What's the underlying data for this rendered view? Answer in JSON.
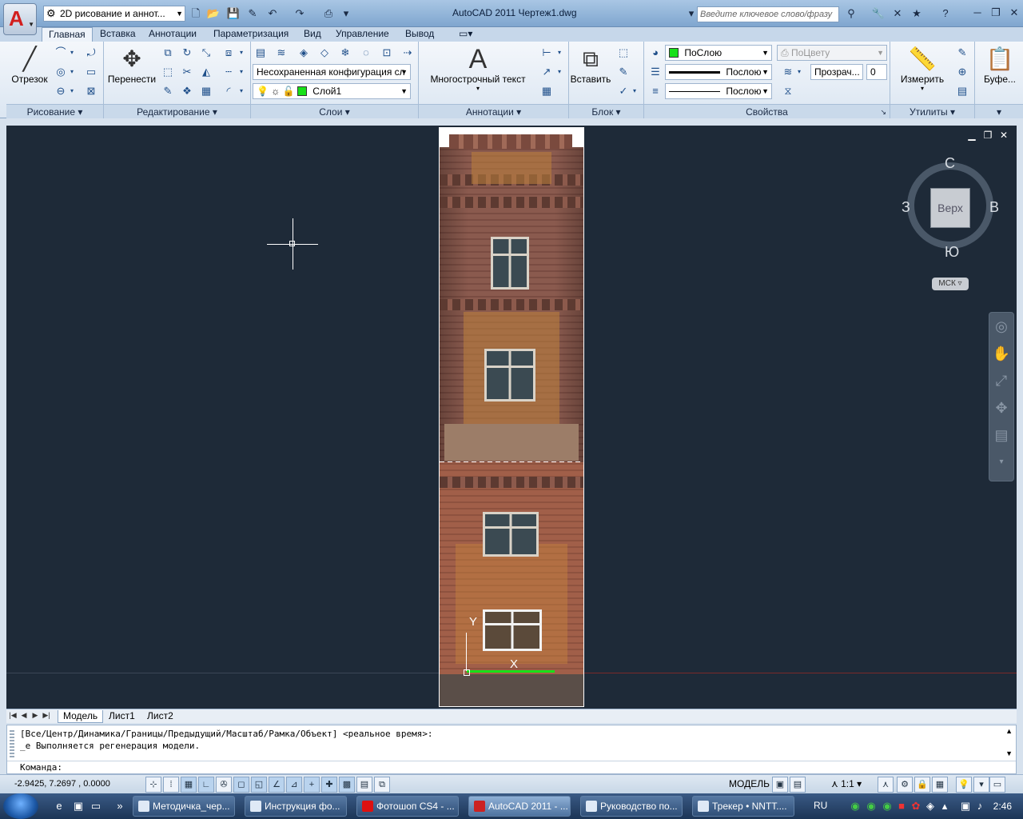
{
  "titlebar": {
    "workspace": "2D рисование и аннот...",
    "app_title": "AutoCAD 2011     Чертеж1.dwg",
    "search_placeholder": "Введите ключевое слово/фразу"
  },
  "ribbon_tabs": [
    "Главная",
    "Вставка",
    "Аннотации",
    "Параметризация",
    "Вид",
    "Управление",
    "Вывод"
  ],
  "panels": {
    "draw": {
      "title": "Рисование",
      "line_label": "Отрезок"
    },
    "modify": {
      "title": "Редактирование",
      "move_label": "Перенести"
    },
    "layers": {
      "title": "Слои",
      "state_combo": "Несохраненная конфигурация сл",
      "layer_combo": "Слой1"
    },
    "annotation": {
      "title": "Аннотации",
      "mtext_label": "Многострочный текст"
    },
    "block": {
      "title": "Блок",
      "insert_label": "Вставить"
    },
    "properties": {
      "title": "Свойства",
      "color_combo": "ПоСлою",
      "lineweight_combo": "Послою",
      "linetype_combo": "Послою",
      "plotstyle_combo": "ПоЦвету",
      "transparency_label": "Прозрач...",
      "transparency_value": "0"
    },
    "utilities": {
      "title": "Утилиты",
      "measure_label": "Измерить"
    },
    "clipboard": {
      "label": "Буфе..."
    }
  },
  "viewcube": {
    "north": "С",
    "south": "Ю",
    "east": "В",
    "west": "З",
    "face": "Верх",
    "ucs": "МСК"
  },
  "ucs_icon": {
    "y": "Y",
    "x": "X"
  },
  "layout_tabs": [
    "Модель",
    "Лист1",
    "Лист2"
  ],
  "command": {
    "line1": "[Все/Центр/Динамика/Границы/Предыдущий/Масштаб/Рамка/Объект] <реальное время>:",
    "line2": "_е Выполняется регенерация модели.",
    "prompt": "Команда:"
  },
  "statusbar": {
    "coords": "-2.9425, 7.2697 , 0.0000",
    "model": "МОДЕЛЬ",
    "scale": "1:1"
  },
  "taskbar": {
    "apps": [
      "Методичка_чер...",
      "Инструкция фо...",
      "Фотошоп CS4 - ...",
      "AutoCAD 2011 - ...",
      "Руководство по...",
      "Трекер • NNTT...."
    ],
    "lang": "RU",
    "clock": "2:46"
  },
  "colors": {
    "layer_swatch": "#18e018",
    "ucs_x_axis": "#18e018",
    "drawing_bg": "#1e2a38"
  }
}
